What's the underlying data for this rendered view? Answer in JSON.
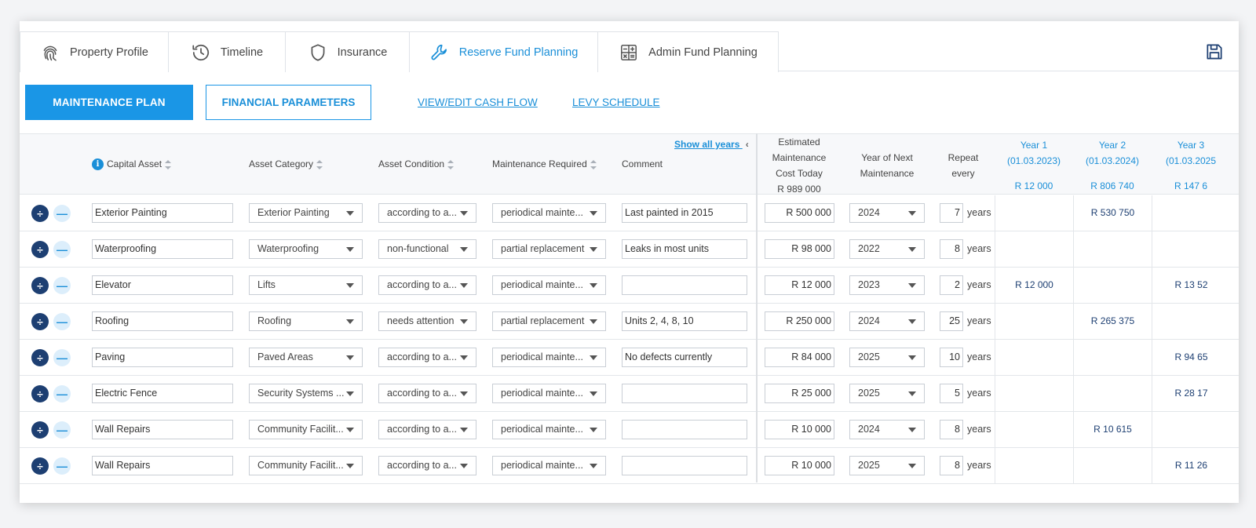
{
  "tabs": [
    {
      "label": "Property Profile",
      "icon": "fingerprint-icon"
    },
    {
      "label": "Timeline",
      "icon": "history-icon"
    },
    {
      "label": "Insurance",
      "icon": "shield-icon"
    },
    {
      "label": "Reserve Fund Planning",
      "icon": "wrench-icon",
      "active": true
    },
    {
      "label": "Admin Fund Planning",
      "icon": "calculator-icon"
    }
  ],
  "subnav": {
    "maintenance_plan": "MAINTENANCE PLAN",
    "financial_parameters": "FINANCIAL PARAMETERS",
    "view_edit_cash_flow": "VIEW/EDIT CASH FLOW",
    "levy_schedule": "LEVY SCHEDULE"
  },
  "table": {
    "headers": {
      "capital_asset": "Capital Asset",
      "asset_category": "Asset Category",
      "asset_condition": "Asset Condition",
      "maintenance_required": "Maintenance Required",
      "comment": "Comment",
      "show_all_years": "Show all years",
      "estimated_cost_l1": "Estimated",
      "estimated_cost_l2": "Maintenance",
      "estimated_cost_l3": "Cost Today",
      "estimated_total": "R 989 000",
      "next_year_l1": "Year of Next",
      "next_year_l2": "Maintenance",
      "repeat_l1": "Repeat",
      "repeat_l2": "every"
    },
    "years": [
      {
        "label": "Year 1",
        "date": "(01.03.2023)",
        "total": "R 12 000"
      },
      {
        "label": "Year 2",
        "date": "(01.03.2024)",
        "total": "R 806 740"
      },
      {
        "label": "Year 3",
        "date": "(01.03.2025",
        "total": "R 147 6"
      }
    ],
    "years_unit": "years",
    "rows": [
      {
        "asset": "Exterior Painting",
        "category": "Exterior Painting",
        "condition": "according to a...",
        "maintenance": "periodical mainte...",
        "comment": "Last painted in 2015",
        "cost": "R 500 000",
        "next_year": "2024",
        "repeat": "7",
        "y1": "",
        "y2": "R 530 750",
        "y3": ""
      },
      {
        "asset": "Waterproofing",
        "category": "Waterproofing",
        "condition": "non-functional",
        "maintenance": "partial replacement",
        "comment": "Leaks in most units",
        "cost": "R 98 000",
        "next_year": "2022",
        "repeat": "8",
        "y1": "",
        "y2": "",
        "y3": ""
      },
      {
        "asset": "Elevator",
        "category": "Lifts",
        "condition": "according to a...",
        "maintenance": "periodical mainte...",
        "comment": "",
        "cost": "R 12 000",
        "next_year": "2023",
        "repeat": "2",
        "y1": "R 12 000",
        "y2": "",
        "y3": "R 13 52"
      },
      {
        "asset": "Roofing",
        "category": "Roofing",
        "condition": "needs attention",
        "maintenance": "partial replacement",
        "comment": "Units 2, 4, 8, 10",
        "cost": "R 250 000",
        "next_year": "2024",
        "repeat": "25",
        "y1": "",
        "y2": "R 265 375",
        "y3": ""
      },
      {
        "asset": "Paving",
        "category": "Paved Areas",
        "condition": "according to a...",
        "maintenance": "periodical mainte...",
        "comment": "No defects currently",
        "cost": "R 84 000",
        "next_year": "2025",
        "repeat": "10",
        "y1": "",
        "y2": "",
        "y3": "R 94 65"
      },
      {
        "asset": "Electric Fence",
        "category": "Security Systems ...",
        "condition": "according to a...",
        "maintenance": "periodical mainte...",
        "comment": "",
        "cost": "R 25 000",
        "next_year": "2025",
        "repeat": "5",
        "y1": "",
        "y2": "",
        "y3": "R 28 17"
      },
      {
        "asset": "Wall Repairs",
        "category": "Community Facilit...",
        "condition": "according to a...",
        "maintenance": "periodical mainte...",
        "comment": "",
        "cost": "R 10 000",
        "next_year": "2024",
        "repeat": "8",
        "y1": "",
        "y2": "R 10 615",
        "y3": ""
      },
      {
        "asset": "Wall Repairs",
        "category": "Community Facilit...",
        "condition": "according to a...",
        "maintenance": "periodical mainte...",
        "comment": "",
        "cost": "R 10 000",
        "next_year": "2025",
        "repeat": "8",
        "y1": "",
        "y2": "",
        "y3": "R 11 26"
      }
    ]
  },
  "colors": {
    "accent": "#1a96e6",
    "dark_blue": "#1d3f72"
  }
}
